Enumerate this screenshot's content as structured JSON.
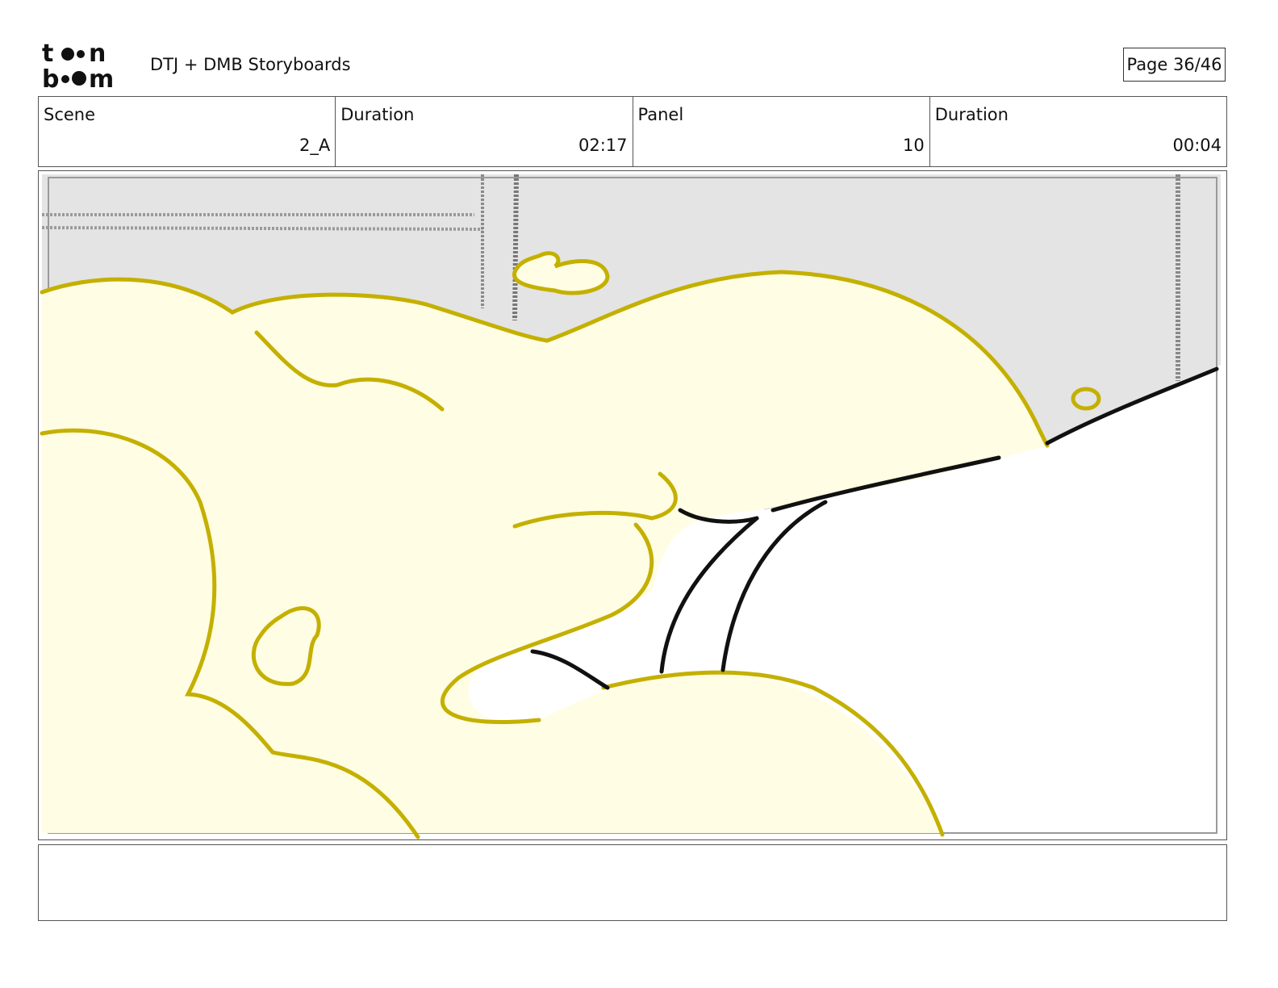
{
  "header": {
    "logo_top": "to•n",
    "logo_bottom": "b••m",
    "title": "DTJ + DMB Storyboards",
    "page": "Page 36/46"
  },
  "info": {
    "scene_label": "Scene",
    "scene_value": "2_A",
    "scene_duration_label": "Duration",
    "scene_duration_value": "02:17",
    "panel_label": "Panel",
    "panel_value": "10",
    "panel_duration_label": "Duration",
    "panel_duration_value": "00:04"
  },
  "notes": {
    "text": ""
  },
  "colors": {
    "sketch_outline": "#c4b000",
    "sketch_fill": "#fffde3",
    "background_wall": "#e4e4e4",
    "ink": "#111111"
  }
}
